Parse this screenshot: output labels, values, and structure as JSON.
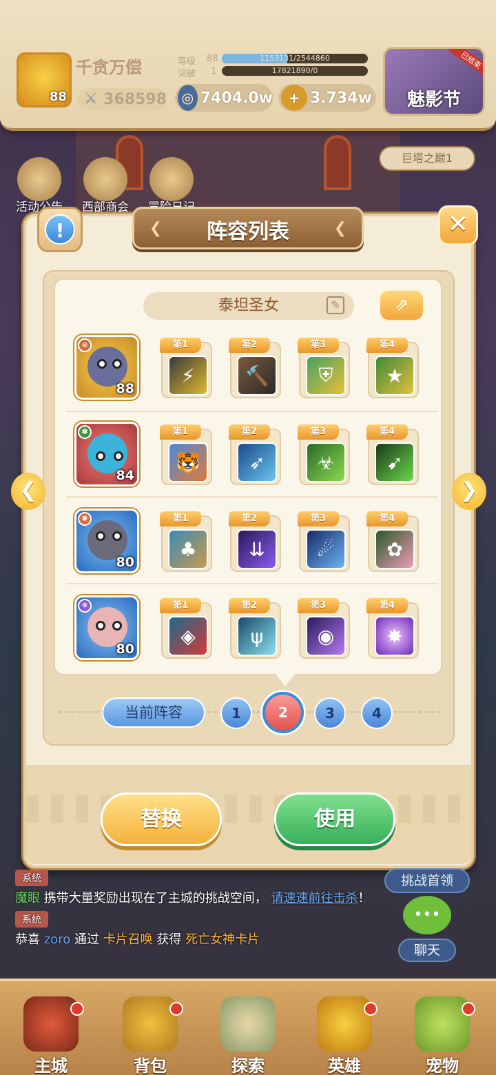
{
  "player": {
    "name": "千贪万偿",
    "level": "88",
    "power": "368598"
  },
  "stats": {
    "level_label": "等级",
    "level_value": "88",
    "level_exp": "1153131/2544860",
    "level_fill": 0.45,
    "break_label": "突破",
    "break_value": "1",
    "break_exp": "17821890/0",
    "break_fill": 0.0
  },
  "resources": {
    "coins": "7404.0w",
    "gems": "3.734w",
    "plus": "+"
  },
  "event": {
    "label": "魅影节",
    "tag": "已结束"
  },
  "quick": [
    {
      "label": "活动公告"
    },
    {
      "label": "西部商会"
    },
    {
      "label": "冒险日记"
    }
  ],
  "tower_label": "巨塔之巅1",
  "modal": {
    "title": "阵容列表",
    "info": "!",
    "close": "✕",
    "team_name": "泰坦圣女",
    "rows": [
      {
        "level": "88",
        "skills": [
          "第1",
          "第2",
          "第3",
          "第4"
        ]
      },
      {
        "level": "84",
        "skills": [
          "第1",
          "第2",
          "第3",
          "第4"
        ]
      },
      {
        "level": "80",
        "skills": [
          "第1",
          "第2",
          "第3",
          "第4"
        ]
      },
      {
        "level": "80",
        "skills": [
          "第1",
          "第2",
          "第3",
          "第4"
        ]
      }
    ],
    "current_label": "当前阵容",
    "team_tabs": [
      "1",
      "2",
      "3",
      "4"
    ],
    "active_tab": "2",
    "replace": "替换",
    "use": "使用"
  },
  "chat": {
    "sys_label": "系统",
    "msg1": {
      "name": "魔眼",
      "text1": "携带大量奖励出现在了主城的挑战空间，",
      "link": "请速速前往击杀",
      "end": "！"
    },
    "msg2": {
      "pre": "恭喜",
      "user": "zoro",
      "mid": "通过",
      "method": "卡片召唤",
      "get": "获得",
      "item": "死亡女神卡片"
    }
  },
  "side": {
    "boss": "挑战首领",
    "chat": "聊天"
  },
  "nav": [
    {
      "label": "主城"
    },
    {
      "label": "背包"
    },
    {
      "label": "探索"
    },
    {
      "label": "英雄"
    },
    {
      "label": "宠物"
    }
  ],
  "colors": {
    "accent": "#f3a63a",
    "green": "#38b05a",
    "blue": "#4c86d8",
    "active": "#e0534d"
  }
}
